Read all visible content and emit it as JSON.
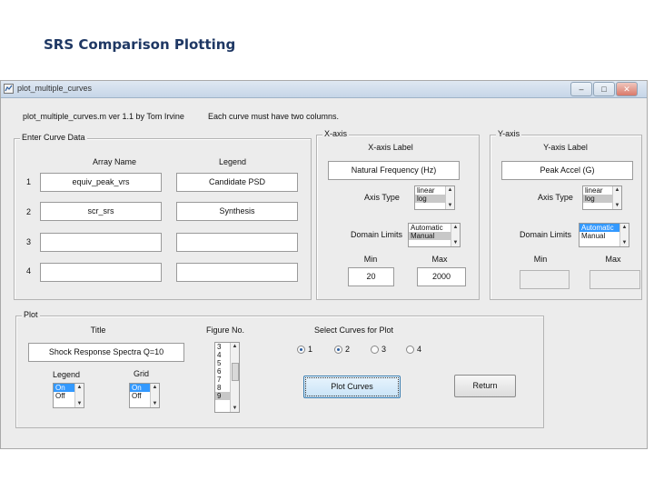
{
  "slide_title": "SRS Comparison Plotting",
  "window": {
    "title": "plot_multiple_curves",
    "controls": [
      "–",
      "□",
      "✕"
    ]
  },
  "header": {
    "version_text": "plot_multiple_curves.m ver 1.1  by Tom Irvine",
    "note": "Each curve must have two columns."
  },
  "enter_curve_data": {
    "title": "Enter Curve Data",
    "col_array": "Array Name",
    "col_legend": "Legend",
    "rows": [
      {
        "num": "1",
        "array": "equiv_peak_vrs",
        "legend": "Candidate PSD"
      },
      {
        "num": "2",
        "array": "scr_srs",
        "legend": "Synthesis"
      },
      {
        "num": "3",
        "array": "",
        "legend": ""
      },
      {
        "num": "4",
        "array": "",
        "legend": ""
      }
    ]
  },
  "x_axis": {
    "title": "X-axis",
    "label_heading": "X-axis Label",
    "label_value": "Natural Frequency (Hz)",
    "axis_type_label": "Axis Type",
    "axis_type_options": [
      "linear",
      "log"
    ],
    "axis_type_selected": "log",
    "domain_limits_label": "Domain Limits",
    "domain_limits_options": [
      "Automatic",
      "Manual"
    ],
    "domain_limits_selected": "Manual",
    "min_label": "Min",
    "max_label": "Max",
    "min_value": "20",
    "max_value": "2000"
  },
  "y_axis": {
    "title": "Y-axis",
    "label_heading": "Y-axis Label",
    "label_value": "Peak Accel (G)",
    "axis_type_label": "Axis Type",
    "axis_type_options": [
      "linear",
      "log"
    ],
    "axis_type_selected": "log",
    "domain_limits_label": "Domain Limits",
    "domain_limits_options": [
      "Automatic",
      "Manual"
    ],
    "domain_limits_selected": "Automatic",
    "min_label": "Min",
    "max_label": "Max"
  },
  "plot": {
    "title": "Plot",
    "title_label": "Title",
    "title_value": "Shock Response Spectra Q=10",
    "figure_label": "Figure No.",
    "figure_options": [
      "3",
      "4",
      "5",
      "6",
      "7",
      "8",
      "9"
    ],
    "figure_selected": "9",
    "select_curves_label": "Select Curves for Plot",
    "curve_options": [
      {
        "label": "1",
        "selected": true
      },
      {
        "label": "2",
        "selected": true
      },
      {
        "label": "3",
        "selected": false
      },
      {
        "label": "4",
        "selected": false
      }
    ],
    "legend_label": "Legend",
    "legend_options": [
      "On",
      "Off"
    ],
    "legend_selected": "On",
    "grid_label": "Grid",
    "grid_options": [
      "On",
      "Off"
    ],
    "grid_selected": "On",
    "plot_button": "Plot Curves",
    "return_button": "Return"
  }
}
